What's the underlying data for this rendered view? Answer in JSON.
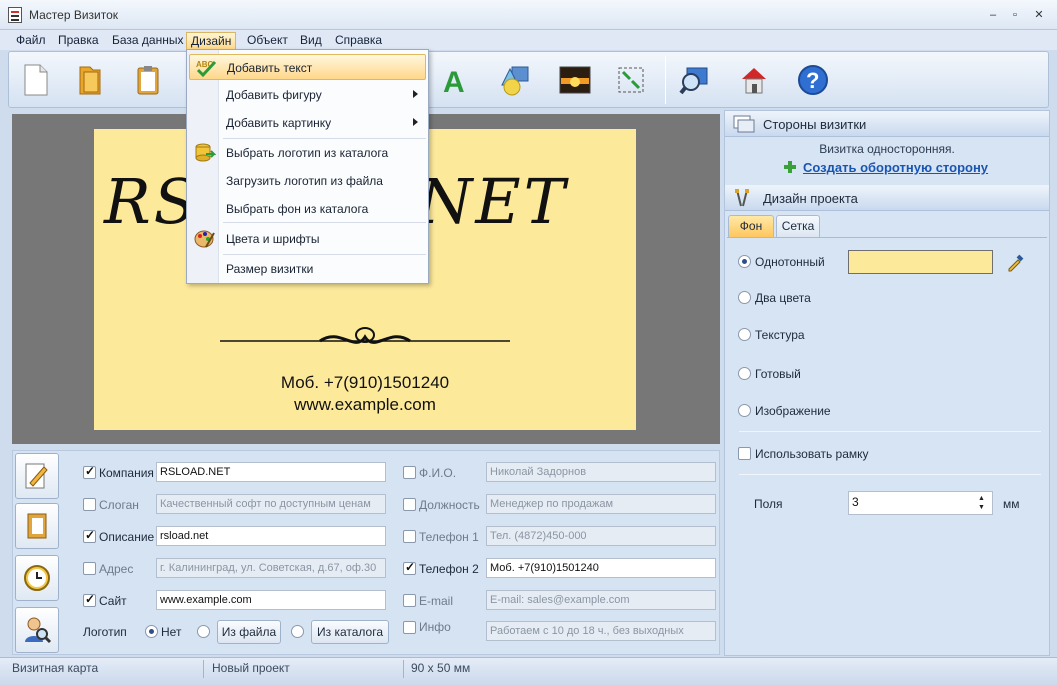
{
  "window": {
    "title": "Мастер Визиток",
    "controls": [
      "–",
      "▫",
      "✕"
    ]
  },
  "menu": [
    "Файл",
    "Правка",
    "База данных",
    "Дизайн",
    "Объект",
    "Вид",
    "Справка"
  ],
  "toolbar_icons": [
    "new-file-icon",
    "open-folder-icon",
    "clipboard-icon",
    "text-a-icon",
    "shapes-icon",
    "sunset-image-icon",
    "resize-icon",
    "search-icon",
    "home-icon",
    "help-icon"
  ],
  "dropdown": {
    "items": [
      {
        "label": "Добавить текст",
        "icon": "abc-check-icon",
        "highlight": true
      },
      {
        "label": "Добавить фигуру",
        "submenu": true
      },
      {
        "label": "Добавить картинку",
        "submenu": true
      },
      {
        "label": "Выбрать логотип из каталога",
        "icon": "database-logo-icon"
      },
      {
        "label": "Загрузить логотип из файла"
      },
      {
        "label": "Выбрать фон из каталога"
      },
      {
        "label": "Цвета и шрифты",
        "icon": "palette-icon"
      },
      {
        "label": "Размер визитки"
      }
    ]
  },
  "card": {
    "brand": "RSLOAD.NET",
    "phone": "Моб. +7(910)1501240",
    "site": "www.example.com",
    "background": "#fde99a"
  },
  "form": {
    "left": [
      {
        "label": "Компания",
        "checked": true,
        "value": "RSLOAD.NET",
        "filled": true
      },
      {
        "label": "Слоган",
        "checked": false,
        "value": "Качественный софт по доступным ценам",
        "filled": false
      },
      {
        "label": "Описание",
        "checked": true,
        "value": "rsload.net",
        "filled": true
      },
      {
        "label": "Адрес",
        "checked": false,
        "value": "г. Калининград, ул. Советская, д.67, оф.30",
        "filled": false
      },
      {
        "label": "Сайт",
        "checked": true,
        "value": "www.example.com",
        "filled": true
      }
    ],
    "right": [
      {
        "label": "Ф.И.О.",
        "checked": false,
        "value": "Николай Задорнов",
        "filled": false
      },
      {
        "label": "Должность",
        "checked": false,
        "value": "Менеджер по продажам",
        "filled": false
      },
      {
        "label": "Телефон 1",
        "checked": false,
        "value": "Тел. (4872)450-000",
        "filled": false
      },
      {
        "label": "Телефон 2",
        "checked": true,
        "value": "Моб. +7(910)1501240",
        "filled": true
      },
      {
        "label": "E-mail",
        "checked": false,
        "value": "E-mail: sales@example.com",
        "filled": false
      },
      {
        "label": "Инфо",
        "checked": false,
        "value": "Работаем с 10 до 18 ч., без выходных",
        "filled": false
      }
    ],
    "logo": {
      "label": "Логотип",
      "options": [
        "Нет",
        "Из файла",
        "Из каталога"
      ],
      "selected": "Нет"
    }
  },
  "right_panel": {
    "sides_header": "Стороны визитки",
    "sides_text": "Визитка односторонняя.",
    "create_back": "Создать оборотную сторону",
    "design_header": "Дизайн проекта",
    "tabs": [
      "Фон",
      "Сетка"
    ],
    "active_tab": "Фон",
    "bg_options": [
      "Однотонный",
      "Два цвета",
      "Текстура",
      "Готовый",
      "Изображение"
    ],
    "bg_selected": "Однотонный",
    "bg_color": "#fde99a",
    "use_frame": "Использовать рамку",
    "margins_label": "Поля",
    "margins_value": "3",
    "margins_unit": "мм"
  },
  "status": [
    "Визитная карта",
    "Новый проект",
    "90 x 50 мм"
  ]
}
